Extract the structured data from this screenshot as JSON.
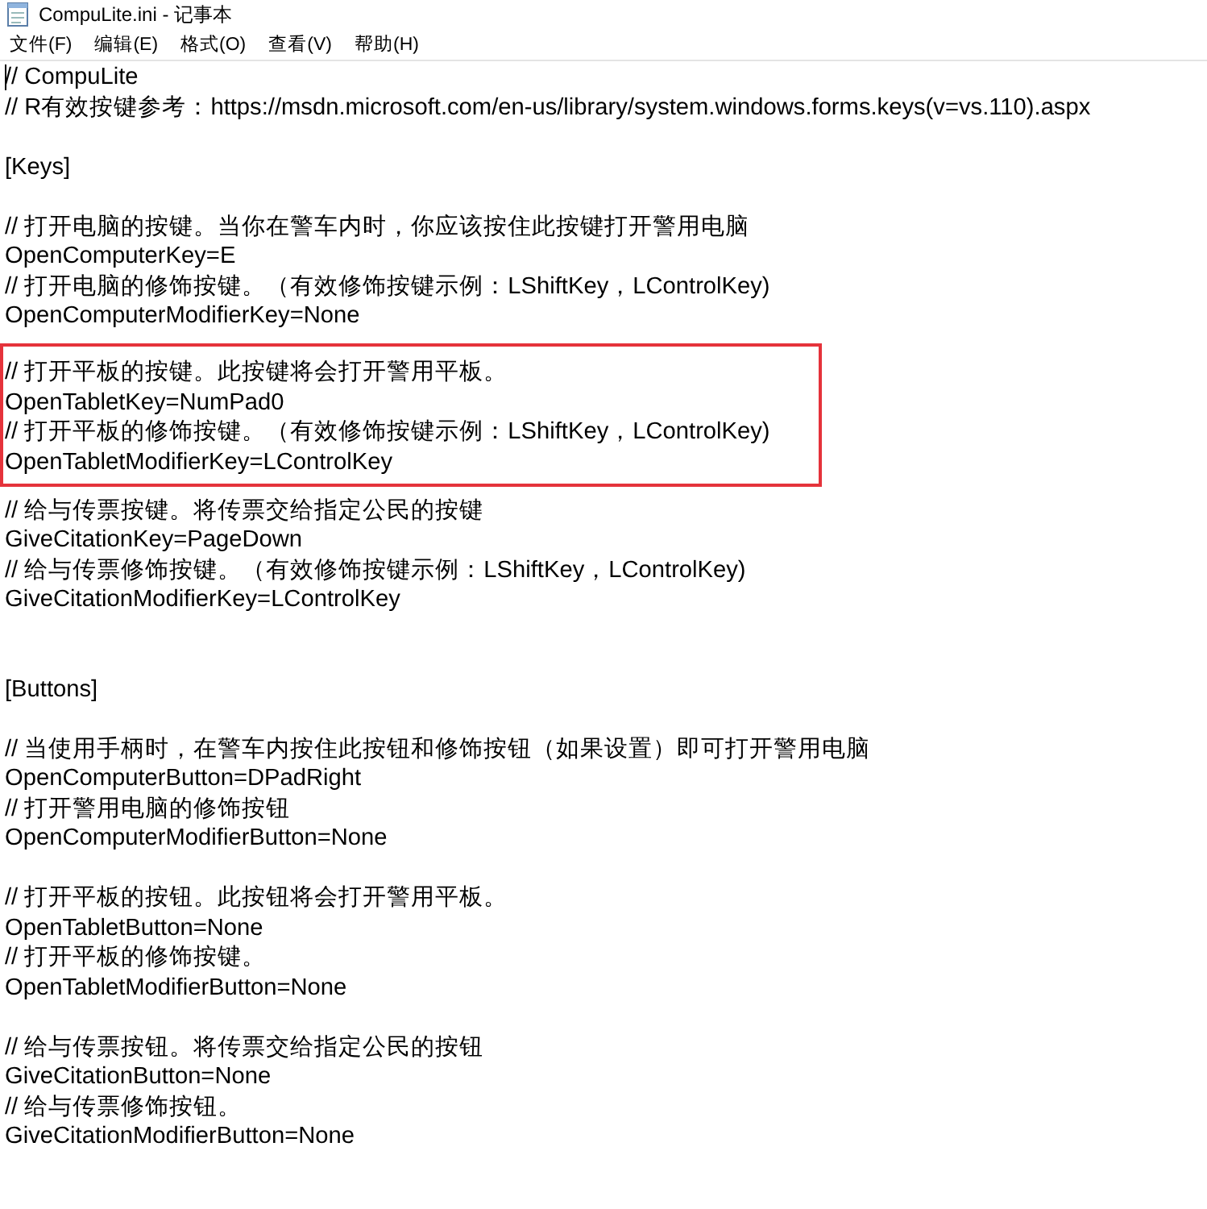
{
  "window": {
    "title": "CompuLite.ini - 记事本"
  },
  "menu": [
    "文件(F)",
    "编辑(E)",
    "格式(O)",
    "查看(V)",
    "帮助(H)"
  ],
  "editor": {
    "caret": true,
    "blocks": [
      {
        "kind": "header",
        "lines": [
          "// CompuLite",
          "// R有效按键参考：https://msdn.microsoft.com/en-us/library/system.windows.forms.keys(v=vs.110).aspx"
        ]
      },
      {
        "kind": "section",
        "lines": [
          "[Keys]"
        ]
      },
      {
        "kind": "settings",
        "highlighted": false,
        "lines": [
          "// 打开电脑的按键。当你在警车内时，你应该按住此按键打开警用电脑",
          "OpenComputerKey=E",
          "// 打开电脑的修饰按键。（有效修饰按键示例：LShiftKey，LControlKey)",
          "OpenComputerModifierKey=None"
        ]
      },
      {
        "kind": "settings",
        "highlighted": true,
        "lines": [
          "// 打开平板的按键。此按键将会打开警用平板。",
          "OpenTabletKey=NumPad0",
          "// 打开平板的修饰按键。（有效修饰按键示例：LShiftKey，LControlKey)",
          "OpenTabletModifierKey=LControlKey"
        ]
      },
      {
        "kind": "settings",
        "highlighted": false,
        "lines": [
          "// 给与传票按键。将传票交给指定公民的按键",
          "GiveCitationKey=PageDown",
          "// 给与传票修饰按键。（有效修饰按键示例：LShiftKey，LControlKey)",
          "GiveCitationModifierKey=LControlKey"
        ]
      },
      {
        "kind": "section",
        "lines": [
          "[Buttons]"
        ]
      },
      {
        "kind": "settings",
        "highlighted": false,
        "lines": [
          "// 当使用手柄时，在警车内按住此按钮和修饰按钮（如果设置）即可打开警用电脑",
          "OpenComputerButton=DPadRight",
          "// 打开警用电脑的修饰按钮",
          "OpenComputerModifierButton=None"
        ]
      },
      {
        "kind": "settings",
        "highlighted": false,
        "lines": [
          "// 打开平板的按钮。此按钮将会打开警用平板。",
          "OpenTabletButton=None",
          "// 打开平板的修饰按键。",
          "OpenTabletModifierButton=None"
        ]
      },
      {
        "kind": "settings",
        "highlighted": false,
        "lines": [
          "// 给与传票按钮。将传票交给指定公民的按钮",
          "GiveCitationButton=None",
          "// 给与传票修饰按钮。",
          "GiveCitationModifierButton=None"
        ]
      }
    ]
  }
}
